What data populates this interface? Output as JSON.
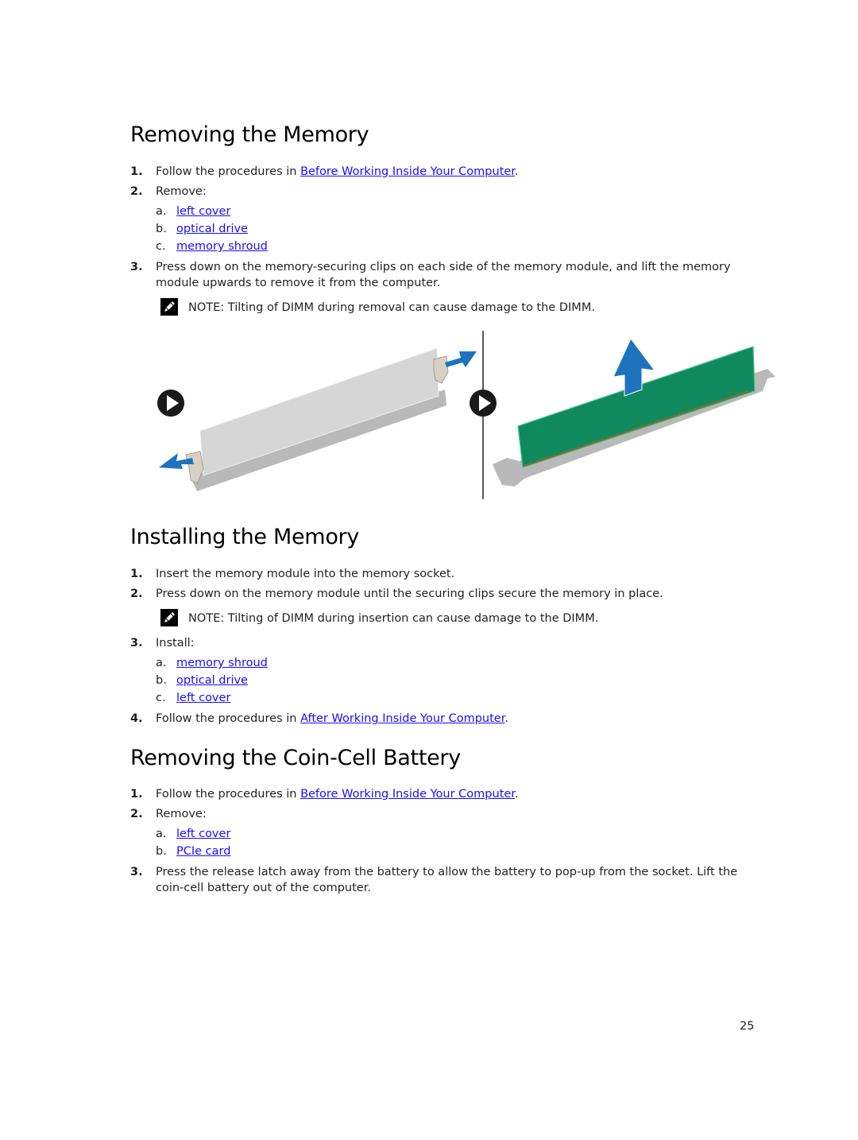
{
  "page_number": "25",
  "sections": [
    {
      "title": "Removing the Memory",
      "step1": {
        "num": "1.",
        "text_before": "Follow the procedures in ",
        "link": "Before Working Inside Your Computer",
        "text_after": "."
      },
      "step2": {
        "num": "2.",
        "text": "Remove:",
        "items": [
          {
            "letter": "a.",
            "link": "left cover"
          },
          {
            "letter": "b.",
            "link": "optical drive"
          },
          {
            "letter": "c.",
            "link": "memory shroud"
          }
        ]
      },
      "step3": {
        "num": "3.",
        "text": "Press down on the memory-securing clips on each side of the memory module, and lift the memory module upwards to remove it from the computer."
      },
      "note": {
        "label": "NOTE:",
        "text": " Tilting of DIMM during removal can cause damage to the DIMM."
      }
    },
    {
      "title": "Installing the Memory",
      "step1": {
        "num": "1.",
        "text": "Insert the memory module into the memory socket."
      },
      "step2": {
        "num": "2.",
        "text": "Press down on the memory module until the securing clips secure the memory in place."
      },
      "note": {
        "label": "NOTE:",
        "text": " Tilting of DIMM during insertion can cause damage to the DIMM."
      },
      "step3": {
        "num": "3.",
        "text": "Install:",
        "items": [
          {
            "letter": "a.",
            "link": "memory shroud"
          },
          {
            "letter": "b.",
            "link": "optical drive"
          },
          {
            "letter": "c.",
            "link": "left cover"
          }
        ]
      },
      "step4": {
        "num": "4.",
        "text_before": "Follow the procedures in ",
        "link": "After Working Inside Your Computer",
        "text_after": "."
      }
    },
    {
      "title": "Removing the Coin-Cell Battery",
      "step1": {
        "num": "1.",
        "text_before": "Follow the procedures in ",
        "link": "Before Working Inside Your Computer",
        "text_after": "."
      },
      "step2": {
        "num": "2.",
        "text": "Remove:",
        "items": [
          {
            "letter": "a.",
            "link": "left cover"
          },
          {
            "letter": "b.",
            "link": "PCIe card"
          }
        ]
      },
      "step3": {
        "num": "3.",
        "text": "Press the release latch away from the battery to allow the battery to pop-up from the socket. Lift the coin-cell battery out of the computer."
      }
    }
  ],
  "figure": {
    "icons": [
      "play-step-icon",
      "play-step-icon",
      "arrow-up-icon",
      "arrow-out-icon"
    ],
    "colors": {
      "arrow": "#1e73be",
      "module_green": "#0f8a5f",
      "socket_gray": "#b9b9b9",
      "module_gray": "#d6d6d6",
      "clip": "#d9d0c4"
    }
  }
}
